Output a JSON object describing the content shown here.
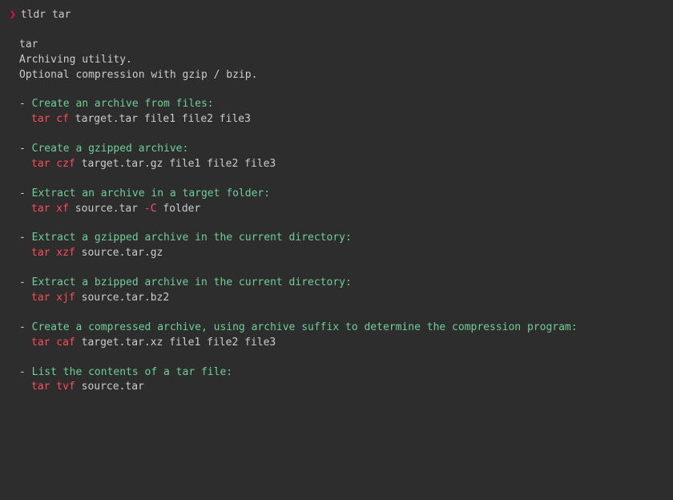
{
  "prompt": {
    "symbol": "❯",
    "command": "tldr tar"
  },
  "header": {
    "title": "tar",
    "desc1": "Archiving utility.",
    "desc2": "Optional compression with gzip / bzip."
  },
  "examples": [
    {
      "desc": "Create an archive from files:",
      "cmd_parts": [
        {
          "text": "tar cf",
          "class": "cmd-red"
        },
        {
          "text": " target.tar file1 file2 file3",
          "class": "cmd-white"
        }
      ]
    },
    {
      "desc": "Create a gzipped archive:",
      "cmd_parts": [
        {
          "text": "tar czf",
          "class": "cmd-red"
        },
        {
          "text": " target.tar.gz file1 file2 file3",
          "class": "cmd-white"
        }
      ]
    },
    {
      "desc": "Extract an archive in a target folder:",
      "cmd_parts": [
        {
          "text": "tar xf",
          "class": "cmd-red"
        },
        {
          "text": " source.tar ",
          "class": "cmd-white"
        },
        {
          "text": "-C",
          "class": "cmd-option"
        },
        {
          "text": " folder",
          "class": "cmd-white"
        }
      ]
    },
    {
      "desc": "Extract a gzipped archive in the current directory:",
      "cmd_parts": [
        {
          "text": "tar xzf",
          "class": "cmd-red"
        },
        {
          "text": " source.tar.gz",
          "class": "cmd-white"
        }
      ]
    },
    {
      "desc": "Extract a bzipped archive in the current directory:",
      "cmd_parts": [
        {
          "text": "tar xjf",
          "class": "cmd-red"
        },
        {
          "text": " source.tar.bz2",
          "class": "cmd-white"
        }
      ]
    },
    {
      "desc": "Create a compressed archive, using archive suffix to determine the compression program:",
      "cmd_parts": [
        {
          "text": "tar caf",
          "class": "cmd-red"
        },
        {
          "text": " target.tar.xz file1 file2 file3",
          "class": "cmd-white"
        }
      ]
    },
    {
      "desc": "List the contents of a tar file:",
      "cmd_parts": [
        {
          "text": "tar tvf",
          "class": "cmd-red"
        },
        {
          "text": " source.tar",
          "class": "cmd-white"
        }
      ]
    }
  ]
}
